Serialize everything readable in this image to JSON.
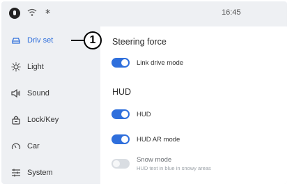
{
  "status_bar": {
    "time": "16:45",
    "bluetooth_glyph": "∗"
  },
  "sidebar": {
    "items": [
      {
        "label": "Driv set",
        "icon": "car-icon",
        "active": true
      },
      {
        "label": "Light",
        "icon": "light-icon",
        "active": false
      },
      {
        "label": "Sound",
        "icon": "speaker-icon",
        "active": false
      },
      {
        "label": "Lock/Key",
        "icon": "lock-icon",
        "active": false
      },
      {
        "label": "Car",
        "icon": "gauge-icon",
        "active": false
      },
      {
        "label": "System",
        "icon": "sliders-icon",
        "active": false
      }
    ]
  },
  "callout": {
    "number": "1"
  },
  "main": {
    "steering": {
      "title": "Steering force",
      "link_drive_mode": {
        "label": "Link drive mode",
        "on": true
      }
    },
    "hud": {
      "title": "HUD",
      "hud_toggle": {
        "label": "HUD",
        "on": true
      },
      "hud_ar_mode": {
        "label": "HUD AR mode",
        "on": true
      },
      "snow_mode": {
        "label": "Snow mode",
        "sublabel": "HUD text in blue in snowy areas",
        "on": false
      }
    }
  },
  "colors": {
    "accent": "#2f6fdc",
    "toggle_off": "#d9dde2",
    "sidebar_bg": "#eef0f3"
  }
}
